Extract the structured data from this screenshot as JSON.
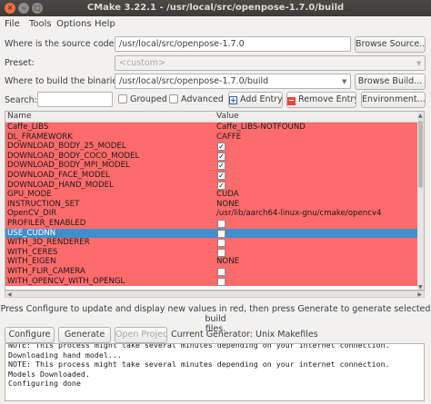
{
  "window": {
    "title": "CMake 3.22.1 - /usr/local/src/openpose-1.7.0/build",
    "close_glyph": "×",
    "min_glyph": "–",
    "max_glyph": "□"
  },
  "menu": [
    "File",
    "Tools",
    "Options",
    "Help"
  ],
  "source": {
    "label": "Where is the source code:",
    "value": "/usr/local/src/openpose-1.7.0",
    "browse": "Browse Source..."
  },
  "preset": {
    "label": "Preset:",
    "value": "<custom>"
  },
  "build": {
    "label": "Where to build the binaries:",
    "value": "/usr/local/src/openpose-1.7.0/build",
    "browse": "Browse Build..."
  },
  "toolbar": {
    "search_label": "Search:",
    "search_value": "",
    "grouped": "Grouped",
    "advanced": "Advanced",
    "add_entry": "Add Entry",
    "remove_entry": "Remove Entry",
    "environment": "Environment..."
  },
  "table": {
    "headers": [
      "Name",
      "Value"
    ],
    "rows": [
      {
        "name": "Caffe_LIBS",
        "value": "Caffe_LIBS-NOTFOUND",
        "check": null
      },
      {
        "name": "DL_FRAMEWORK",
        "value": "CAFFE",
        "check": null
      },
      {
        "name": "DOWNLOAD_BODY_25_MODEL",
        "value": "",
        "check": "✓"
      },
      {
        "name": "DOWNLOAD_BODY_COCO_MODEL",
        "value": "",
        "check": "✓"
      },
      {
        "name": "DOWNLOAD_BODY_MPI_MODEL",
        "value": "",
        "check": "✓"
      },
      {
        "name": "DOWNLOAD_FACE_MODEL",
        "value": "",
        "check": "✓"
      },
      {
        "name": "DOWNLOAD_HAND_MODEL",
        "value": "",
        "check": "✓"
      },
      {
        "name": "GPU_MODE",
        "value": "CUDA",
        "check": null
      },
      {
        "name": "INSTRUCTION_SET",
        "value": "NONE",
        "check": null
      },
      {
        "name": "OpenCV_DIR",
        "value": "/usr/lib/aarch64-linux-gnu/cmake/opencv4",
        "check": null
      },
      {
        "name": "PROFILER_ENABLED",
        "value": "",
        "check": ""
      },
      {
        "name": "USE_CUDNN",
        "value": "",
        "check": "",
        "selected": true
      },
      {
        "name": "WITH_3D_RENDERER",
        "value": "",
        "check": ""
      },
      {
        "name": "WITH_CERES",
        "value": "",
        "check": ""
      },
      {
        "name": "WITH_EIGEN",
        "value": "NONE",
        "check": null
      },
      {
        "name": "WITH_FLIR_CAMERA",
        "value": "",
        "check": ""
      },
      {
        "name": "WITH_OPENCV_WITH_OPENGL",
        "value": "",
        "check": ""
      }
    ]
  },
  "info": {
    "line1": "Press Configure to update and display new values in red, then press Generate to generate selected build",
    "line2": "files."
  },
  "actions": {
    "configure": "Configure",
    "generate": "Generate",
    "open_project": "Open Project",
    "current_generator": "Current Generator: Unix Makefiles"
  },
  "log": [
    "NOTE: This process might take several minutes depending on your internet connection.",
    "Downloading hand model...",
    "NOTE: This process might take several minutes depending on your internet connection.",
    "Models Downloaded.",
    "Configuring done"
  ],
  "colors": {
    "changed_row": "#fe6b6b",
    "selected_row": "#3f8fcf",
    "titlebar": "#3c3b37",
    "close_button": "#f46d3d"
  }
}
